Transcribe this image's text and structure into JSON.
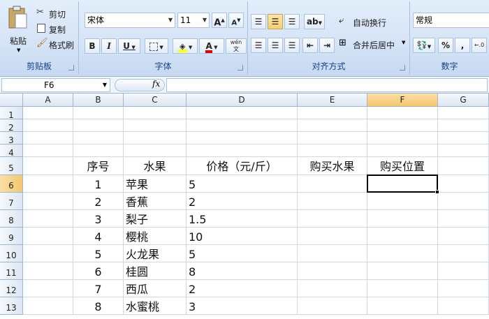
{
  "ribbon": {
    "clipboard": {
      "paste": "粘贴",
      "cut": "剪切",
      "copy": "复制",
      "format_painter": "格式刷",
      "label": "剪贴板"
    },
    "font": {
      "name": "宋体",
      "size": "11",
      "grow": "A",
      "shrink": "A",
      "bold": "B",
      "italic": "I",
      "underline": "U",
      "phonetic": "wén",
      "label": "字体"
    },
    "alignment": {
      "wrap_text": "自动换行",
      "merge_center": "合并后居中",
      "label": "对齐方式"
    },
    "number": {
      "format": "常规",
      "percent": "%",
      "comma": ",",
      "label": "数字"
    }
  },
  "formula_bar": {
    "cell_ref": "F6",
    "fx": "fx",
    "content": ""
  },
  "columns": [
    "A",
    "B",
    "C",
    "D",
    "E",
    "F",
    "G"
  ],
  "rows": [
    "1",
    "2",
    "3",
    "4",
    "5",
    "6",
    "7",
    "8",
    "9",
    "10",
    "11",
    "12",
    "13"
  ],
  "selected_cell": "F6",
  "table": {
    "headers": {
      "no": "序号",
      "fruit": "水果",
      "price": "价格（元/斤）",
      "buy_fruit": "购买水果",
      "buy_position": "购买位置"
    },
    "rows": [
      {
        "no": "1",
        "fruit": "苹果",
        "price": "5"
      },
      {
        "no": "2",
        "fruit": "香蕉",
        "price": "2"
      },
      {
        "no": "3",
        "fruit": "梨子",
        "price": "1.5"
      },
      {
        "no": "4",
        "fruit": "樱桃",
        "price": "10"
      },
      {
        "no": "5",
        "fruit": "火龙果",
        "price": "5"
      },
      {
        "no": "6",
        "fruit": "桂圆",
        "price": "8"
      },
      {
        "no": "7",
        "fruit": "西瓜",
        "price": "2"
      },
      {
        "no": "8",
        "fruit": "水蜜桃",
        "price": "3"
      }
    ]
  }
}
